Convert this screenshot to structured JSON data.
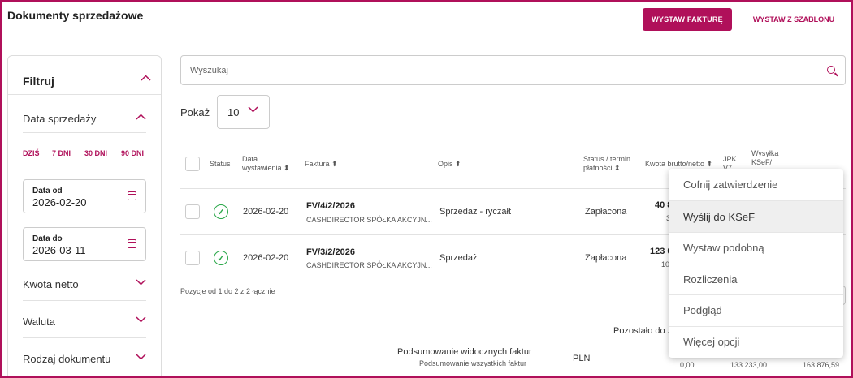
{
  "header": {
    "title": "Dokumenty sprzedażowe",
    "issue_invoice_button": "WYSTAW FAKTURĘ",
    "from_template_button": "WYSTAW Z SZABLONU"
  },
  "filters": {
    "title": "Filtruj",
    "sale_date": {
      "label": "Data sprzedaży",
      "quick_links": [
        "DZIŚ",
        "7 DNI",
        "30 DNI",
        "90 DNI"
      ],
      "date_from_label": "Data od",
      "date_from_value": "2026-02-20",
      "date_to_label": "Data do",
      "date_to_value": "2026-03-11"
    },
    "sections": [
      "Kwota netto",
      "Waluta",
      "Rodzaj dokumentu"
    ]
  },
  "search": {
    "placeholder": "Wyszukaj"
  },
  "pagination": {
    "show_label": "Pokaż",
    "page_size": "10"
  },
  "table": {
    "headers": {
      "status": "Status",
      "issue_date_line1": "Data",
      "issue_date_line2": "wystawienia",
      "invoice": "Faktura",
      "description": "Opis",
      "payment_status_line1": "Status / termin",
      "payment_status_line2": "płatności",
      "amount": "Kwota brutto/netto",
      "jpk_line1": "JPK",
      "jpk_line2": "V7",
      "ksef_line1": "Wysyłka",
      "ksef_line2": "KSeF/"
    },
    "rows": [
      {
        "date": "2026-02-20",
        "number": "FV/4/2/2026",
        "client": "CASHDIRECTOR SPÓŁKA AKCYJN...",
        "description": "Sprzedaż - ryczałt",
        "payment": "Zapłacona",
        "amount_gross": "40 8",
        "amount_net": "3"
      },
      {
        "date": "2026-02-20",
        "number": "FV/3/2/2026",
        "client": "CASHDIRECTOR SPÓŁKA AKCYJN...",
        "description": "Sprzedaż",
        "payment": "Zapłacona",
        "amount_gross": "123 0",
        "amount_net": "10"
      }
    ],
    "positions_text": "Pozycje od 1 do 2 z 2 łącznie"
  },
  "summary": {
    "remaining_label": "Pozostało do z",
    "visible_label": "Podsumowanie widocznych faktur",
    "all_label": "Podsumowanie wszystkich faktur",
    "currency": "PLN",
    "val1": "0,00",
    "val2": "133 233,00",
    "val3": "163 876,59"
  },
  "context_menu": {
    "items": [
      "Cofnij zatwierdzenie",
      "Wyślij do KSeF",
      "Wystaw podobną",
      "Rozliczenia",
      "Podgląd",
      "Więcej opcji"
    ],
    "active_index": 1
  },
  "colors": {
    "accent": "#b0105a",
    "success": "#2ba84a"
  },
  "icons": {
    "filter_toggle": "chevron-up-icon",
    "section_expanded": "chevron-up-icon",
    "section_collapsed": "chevron-down-icon",
    "calendar": "calendar-icon",
    "search": "search-icon",
    "sort": "sort-icon",
    "status": "check-circle-icon"
  }
}
